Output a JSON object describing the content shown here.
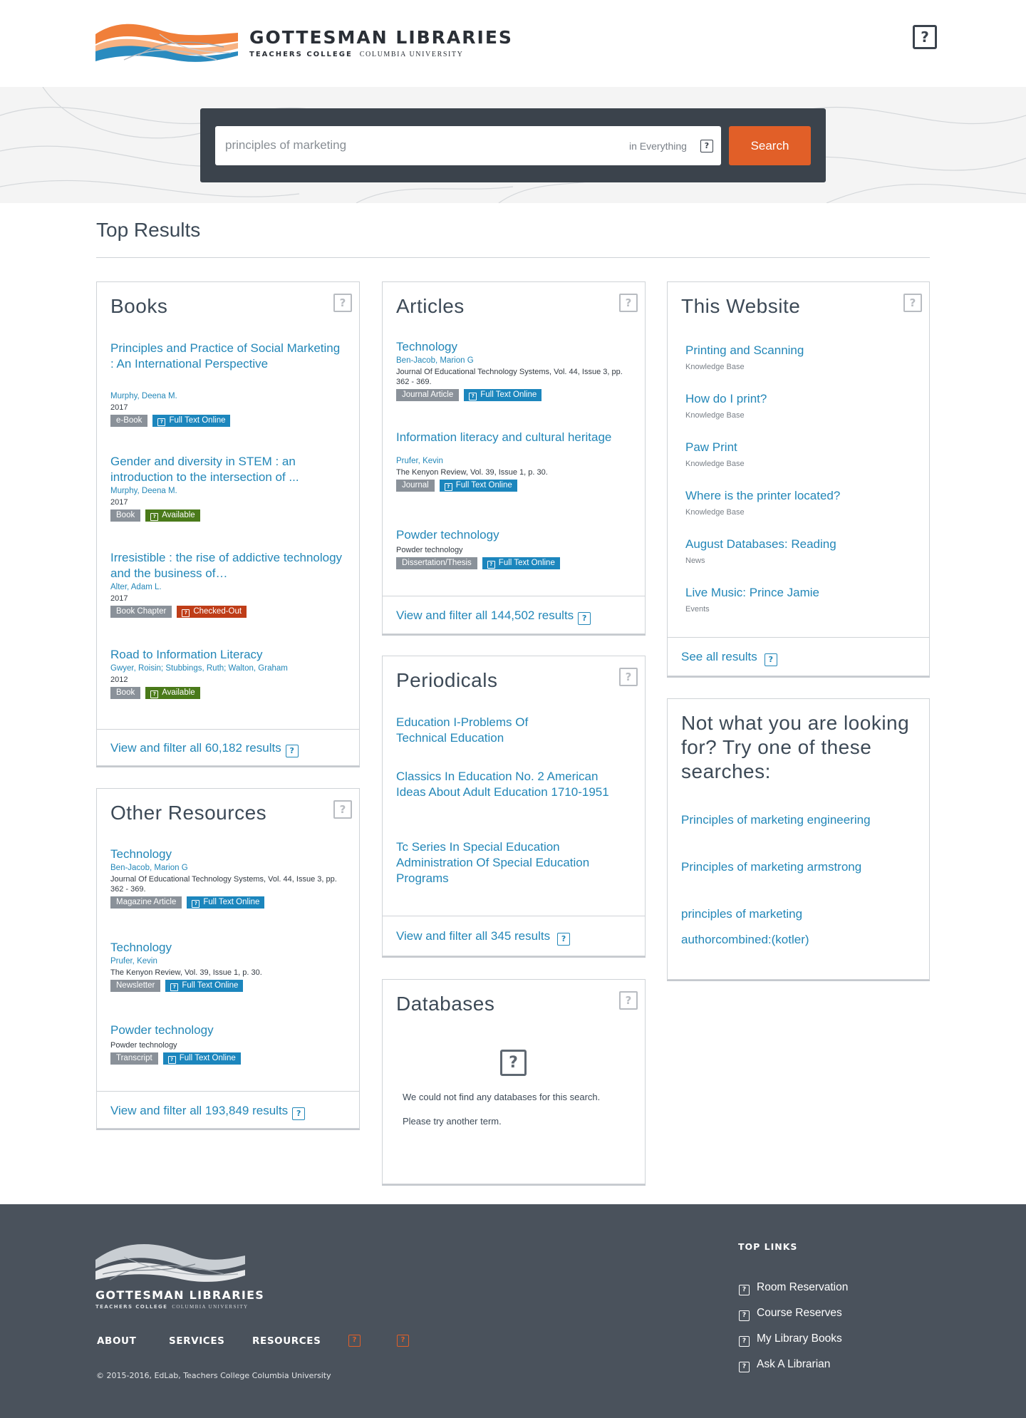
{
  "brand": {
    "name": "GOTTESMAN LIBRARIES",
    "sub_bold": "TEACHERS COLLEGE",
    "sub_serif": "COLUMBIA UNIVERSITY",
    "colors": {
      "orange": "#e15f28",
      "blue": "#2387b8",
      "dark": "#3b434c"
    }
  },
  "header": {
    "help_icon": "question-square-icon"
  },
  "search": {
    "query": "principles of marketing",
    "scope": "in Everything",
    "button": "Search"
  },
  "top_results": {
    "title": "Top Results"
  },
  "books": {
    "title": "Books",
    "items": [
      {
        "title": "Principles and Practice of Social Marketing : An International Perspective",
        "author": "Murphy, Deena M.",
        "year": "2017",
        "type": "e-Book",
        "access": "Full Text Online"
      },
      {
        "title": "Gender and diversity in STEM : an introduction to the intersection of ...",
        "author": "Murphy, Deena M.",
        "year": "2017",
        "type": "Book",
        "access": "Available"
      },
      {
        "title": "Irresistible : the rise of addictive technology and the business of…",
        "author": "Alter, Adam L.",
        "year": "2017",
        "type": "Book Chapter",
        "access": "Checked-Out"
      },
      {
        "title": "Road to Information Literacy",
        "author": "Gwyer, Roisin; Stubbings, Ruth; Walton, Graham",
        "year": "2012",
        "type": "Book",
        "access": "Available"
      }
    ],
    "footer": "View and filter all 60,182 results"
  },
  "other": {
    "title": "Other Resources",
    "items": [
      {
        "title": "Technology",
        "author": "Ben-Jacob, Marion G",
        "meta": "Journal Of Educational Technology Systems, Vol. 44, Issue 3, pp. 362 - 369.",
        "type": "Magazine Article",
        "access": "Full Text Online"
      },
      {
        "title": "Technology",
        "author": "Prufer, Kevin",
        "meta": "The Kenyon Review, Vol. 39, Issue 1, p. 30.",
        "type": "Newsletter",
        "access": "Full Text Online"
      },
      {
        "title": "Powder technology",
        "meta": "Powder technology",
        "type": "Transcript",
        "access": "Full Text Online"
      }
    ],
    "footer": "View and filter all 193,849 results"
  },
  "articles": {
    "title": "Articles",
    "items": [
      {
        "title": "Technology",
        "author": "Ben-Jacob, Marion G",
        "meta": "Journal Of Educational Technology Systems, Vol. 44, Issue 3, pp. 362 - 369.",
        "type": "Journal Article",
        "access": "Full Text Online"
      },
      {
        "title": "Information literacy and cultural heritage",
        "author": "Prufer, Kevin",
        "meta": "The Kenyon Review, Vol. 39, Issue 1, p. 30.",
        "type": "Journal",
        "access": "Full Text Online"
      },
      {
        "title": "Powder technology",
        "meta": "Powder technology",
        "type": "Dissertation/Thesis",
        "access": "Full Text Online"
      }
    ],
    "footer": "View and filter all 144,502 results"
  },
  "periodicals": {
    "title": "Periodicals",
    "items": [
      "Education I-Problems Of Technical Education",
      "Classics In Education No. 2 American Ideas About Adult Education 1710-1951",
      "Tc Series In Special Education Administration Of Special Education Programs"
    ],
    "footer": "View and filter all 345 results"
  },
  "databases": {
    "title": "Databases",
    "msg1": "We could not find any databases for this search.",
    "msg2": "Please try another term."
  },
  "website": {
    "title": "This Website",
    "items": [
      {
        "title": "Printing and Scanning",
        "type": "Knowledge Base"
      },
      {
        "title": "How do I print?",
        "type": "Knowledge Base"
      },
      {
        "title": "Paw Print",
        "type": "Knowledge Base"
      },
      {
        "title": "Where is the printer located?",
        "type": "Knowledge Base"
      },
      {
        "title": "August Databases: Reading",
        "type": "News"
      },
      {
        "title": "Live Music: Prince Jamie",
        "type": "Events"
      }
    ],
    "footer": "See all results"
  },
  "suggest": {
    "title": "Not what you are looking for? Try one of these searches:",
    "items": [
      "Principles of marketing engineering",
      "Principles of marketing armstrong",
      "principles of marketing authorcombined:(kotler)"
    ]
  },
  "footer": {
    "nav": [
      "ABOUT",
      "SERVICES",
      "RESOURCES"
    ],
    "copyright": "© 2015-2016, EdLab, Teachers College Columbia University",
    "top_links_title": "TOP LINKS",
    "top_links": [
      "Room Reservation",
      "Course Reserves",
      "My Library Books",
      "Ask A Librarian"
    ]
  }
}
